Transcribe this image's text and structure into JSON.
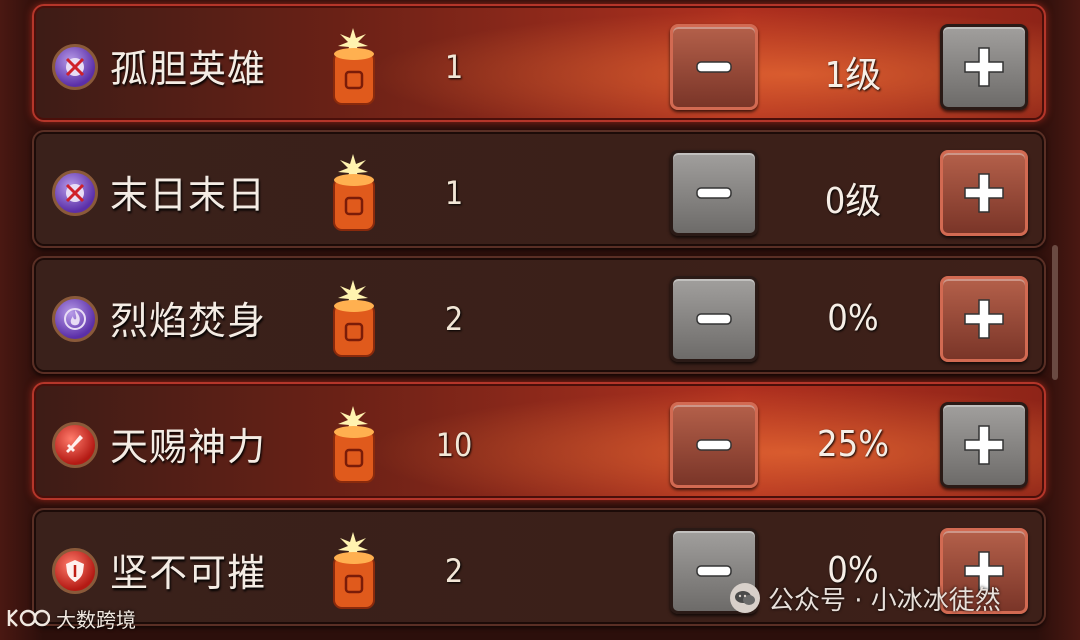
{
  "skills": [
    {
      "name": "孤胆英雄",
      "icon": "lone-hero-icon",
      "icon_style": "purple",
      "cost": "1",
      "value": "1级",
      "active": true,
      "minus_style": "brown",
      "plus_style": "gray"
    },
    {
      "name": "末日末日",
      "icon": "doomsday-icon",
      "icon_style": "purple",
      "cost": "1",
      "value": "0级",
      "active": false,
      "minus_style": "gray",
      "plus_style": "brown"
    },
    {
      "name": "烈焰焚身",
      "icon": "flame-icon",
      "icon_style": "purple",
      "cost": "2",
      "value": "0%",
      "active": false,
      "minus_style": "gray",
      "plus_style": "brown"
    },
    {
      "name": "天赐神力",
      "icon": "sword-icon",
      "icon_style": "red",
      "cost": "10",
      "value": "25%",
      "active": true,
      "minus_style": "brown",
      "plus_style": "gray"
    },
    {
      "name": "坚不可摧",
      "icon": "shield-icon",
      "icon_style": "red",
      "cost": "2",
      "value": "0%",
      "active": false,
      "minus_style": "gray",
      "plus_style": "brown"
    }
  ],
  "cost_item_icon": "firecracker-icon",
  "watermark": {
    "left_text": "大数跨境",
    "right_text": "公众号 · 小冰冰徒然"
  },
  "colors": {
    "active_row": "#b0301f",
    "button_gray": "#8a8886",
    "button_brown": "#9a4a38"
  }
}
